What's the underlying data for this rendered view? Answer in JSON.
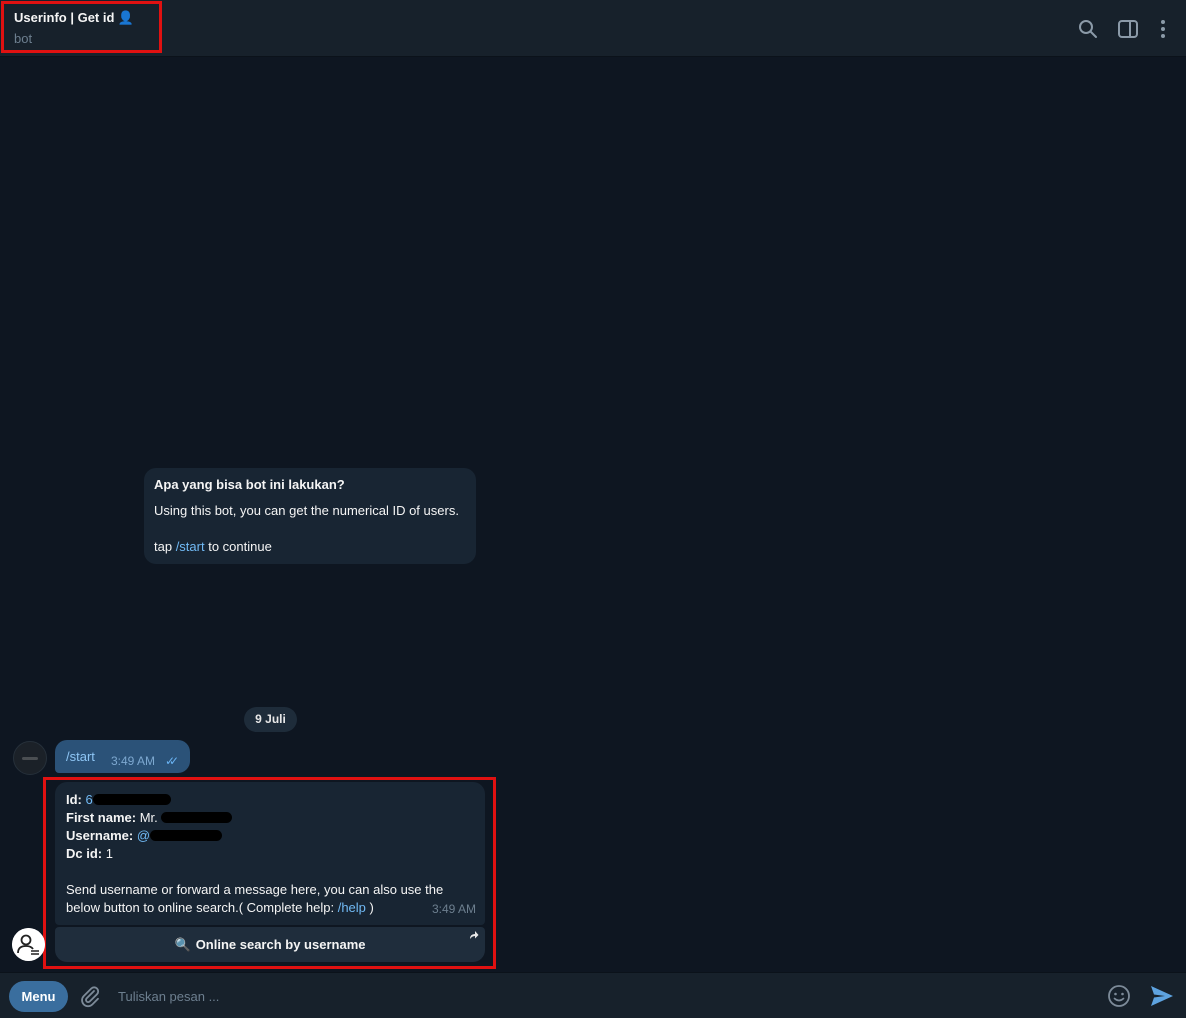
{
  "header": {
    "title": "Userinfo | Get id",
    "title_emoji": "👤",
    "subtitle": "bot",
    "icons": [
      "search-icon",
      "sidebar-toggle-icon",
      "more-vertical-icon"
    ]
  },
  "intro": {
    "question": "Apa yang bisa bot ini lakukan?",
    "description": "Using this bot, you can get the numerical ID of users.",
    "tap_prefix": "tap ",
    "tap_link": "/start",
    "tap_suffix": " to continue"
  },
  "date_separator": "9 Juli",
  "outgoing": {
    "text": "/start",
    "time": "3:49 AM",
    "status": "read"
  },
  "response": {
    "id_label": "Id:",
    "id_value_visible": "6",
    "first_name_label": "First name:",
    "first_name_value_visible": "Mr.",
    "username_label": "Username:",
    "username_value_visible": "@",
    "dc_label": "Dc id:",
    "dc_value": "1",
    "body_text": "Send username or forward a message here, you can also use the below button to online search.( Complete help: ",
    "help_link": "/help",
    "body_close": " )",
    "time": "3:49 AM"
  },
  "inline_button": {
    "icon": "🔍",
    "label": "Online search by username"
  },
  "composer": {
    "menu_label": "Menu",
    "placeholder": "Tuliskan pesan ..."
  },
  "colors": {
    "background": "#0e1621",
    "header": "#17212b",
    "incoming_bubble": "#182533",
    "outgoing_bubble": "#2b5278",
    "link": "#71baf5",
    "highlight_box": "#e01111",
    "menu_button": "#3a6e9e"
  }
}
